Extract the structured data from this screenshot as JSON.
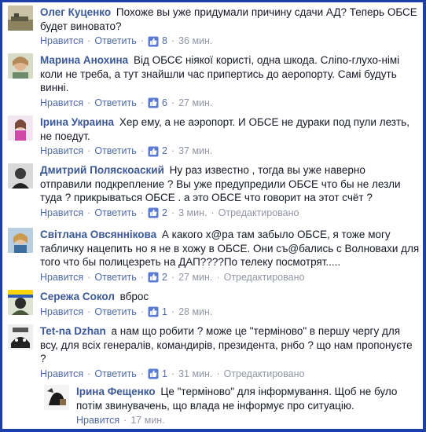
{
  "accent": "#3b5998",
  "frame_color": "#1f3fa8",
  "labels": {
    "like": "Нравится",
    "reply": "Ответить",
    "edited": "Отредактировано",
    "sep": "·"
  },
  "comments": [
    {
      "author": "Олег Куценко",
      "text": "Похоже вы уже придумали причину сдачи АД? Теперь ОБСЕ будет виновато?",
      "likes": "8",
      "time": "36 мин."
    },
    {
      "author": "Марина Анохина",
      "text": "Від ОБСЄ ніякої користі, одна шкода. Сліпо-глухо-німі коли не треба, а тут знайшли час припертись до аеропорту. Самі будуть винні.",
      "likes": "6",
      "time": "27 мин."
    },
    {
      "author": "Ірина Украина",
      "text": "Хер ему, а не аэропорт. И ОБСЕ не дураки под пули лезть, не поедут.",
      "likes": "2",
      "time": "37 мин."
    },
    {
      "author": "Дмитрий Поляскоаский",
      "text": "Ну раз известно , тогда вы уже наверно отправили подкрепление ? Вы уже предупредили ОБСЕ что бы не лезли туда ? прикрываться ОБСЕ . а это ОБСЕ что говорит на этот счёт ?",
      "likes": "2",
      "time": "3 мин.",
      "edited": true
    },
    {
      "author": "Світлана Овсяннікова",
      "text": "А какого х@ра там забыло ОБСЕ, я тоже могу табличку нацепить но я не в хожу в ОБСЕ. Они съ@бались с Волновахи для того что бы полицезреть на ДАП????По телеку посмотрят.....",
      "likes": "2",
      "time": "27 мин.",
      "edited": true
    },
    {
      "author": "Сережа Сокол",
      "text": "вброс",
      "likes": "1",
      "time": "28 мин."
    },
    {
      "author": "Tet-na Dzhan",
      "text": "а нам що робити ? може це \"терміново\" в першу чергу для всу, для всіх генералів, командирів, президента, рнбо ? що нам пропонуєте ?",
      "likes": "1",
      "time": "31 мин.",
      "edited": true
    },
    {
      "author": "Ірина Фещенко",
      "text": "Це \"терміново\" для інформування. Щоб не було потім звинувачень, що влада не інформує про ситуацію.",
      "time": "17 мин.",
      "reply": true
    }
  ]
}
